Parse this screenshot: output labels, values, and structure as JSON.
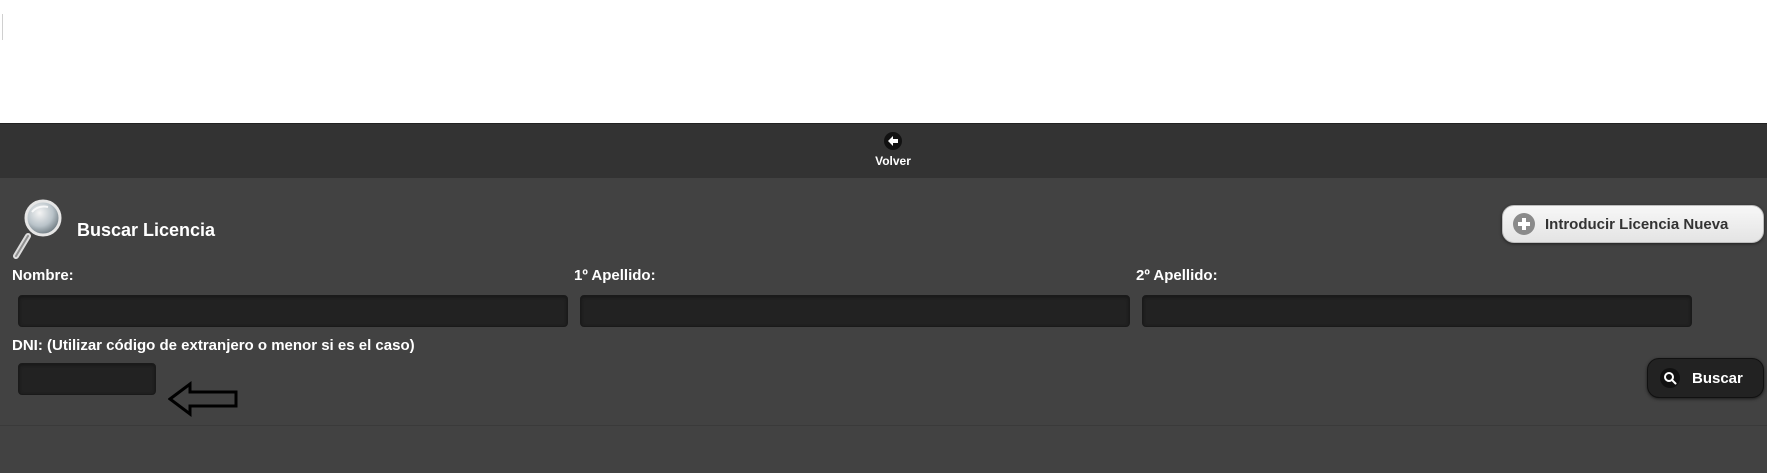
{
  "header": {
    "back_label": "Volver",
    "back_icon": "arrow-left-icon"
  },
  "page": {
    "title": "Buscar Licencia",
    "title_icon": "magnifier-icon",
    "new_license_label": "Introducir Licencia Nueva",
    "new_license_icon": "plus-circle-icon"
  },
  "form": {
    "nombre_label": "Nombre:",
    "nombre_value": "",
    "apellido1_label": "1º Apellido:",
    "apellido1_value": "",
    "apellido2_label": "2º Apellido:",
    "apellido2_value": "",
    "dni_label": "DNI: (Utilizar código de extranjero o menor si es el caso)",
    "dni_value": "",
    "search_label": "Buscar",
    "search_icon": "search-icon"
  },
  "colors": {
    "header_bg": "#333333",
    "content_bg": "#424242",
    "input_bg": "#222222",
    "text": "#ffffff"
  }
}
